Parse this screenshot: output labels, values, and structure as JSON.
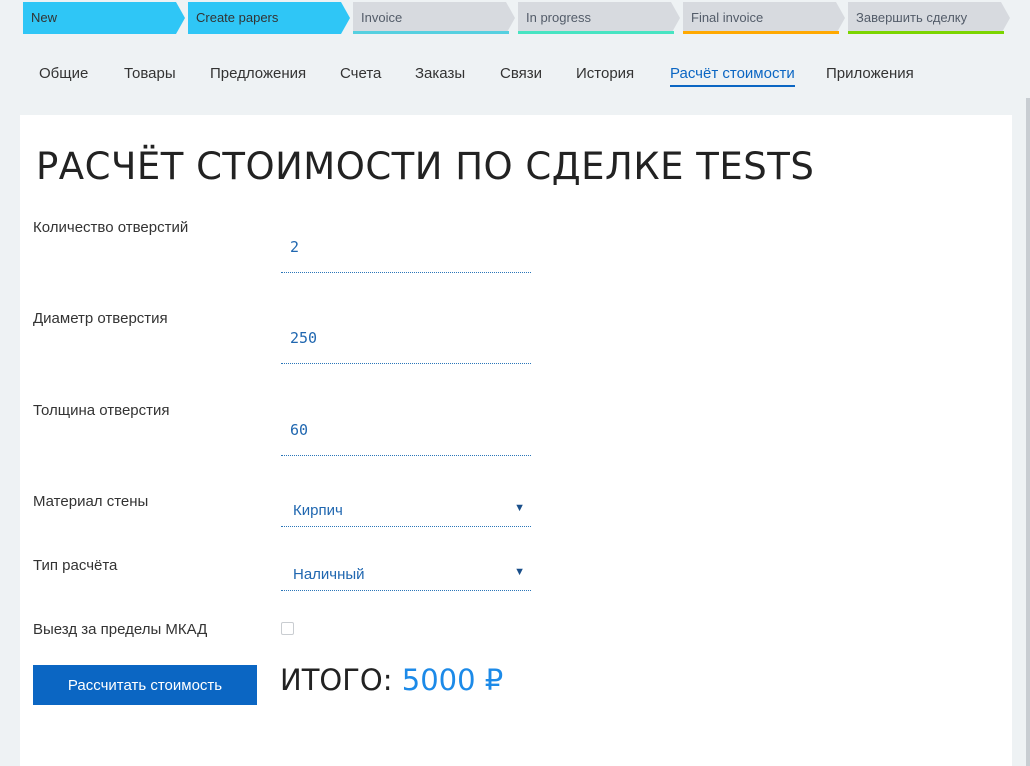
{
  "pipeline": {
    "stages": [
      {
        "label": "New",
        "color": "#2fc6f6"
      },
      {
        "label": "Create papers",
        "color": "#2fc6f6"
      },
      {
        "label": "Invoice",
        "color": "#55d0e0"
      },
      {
        "label": "In progress",
        "color": "#47e4c2"
      },
      {
        "label": "Final invoice",
        "color": "#ffa900"
      },
      {
        "label": "Завершить сделку",
        "color": "#7bd500"
      }
    ]
  },
  "tabs": [
    "Общие",
    "Товары",
    "Предложения",
    "Счета",
    "Заказы",
    "Связи",
    "История",
    "Расчёт стоимости",
    "Приложения"
  ],
  "active_tab": "Расчёт стоимости",
  "form": {
    "title": "РАСЧЁТ СТОИМОСТИ ПО СДЕЛКЕ TESTS",
    "holes_count": {
      "label": "Количество отверстий",
      "value": "2"
    },
    "hole_diameter": {
      "label": "Диаметр отверстия",
      "value": "250"
    },
    "hole_thickness": {
      "label": "Толщина отверстия",
      "value": "60"
    },
    "wall_material": {
      "label": "Материал стены",
      "value": "Кирпич"
    },
    "payment_type": {
      "label": "Тип расчёта",
      "value": "Наличный"
    },
    "outside_mkad": {
      "label": "Выезд за пределы МКАД",
      "checked": false
    },
    "calculate_button": "Рассчитать стоимость",
    "total_label": "ИТОГО:",
    "total_value": "5000 ₽"
  },
  "colors": {
    "accent": "#0b66c3",
    "total": "#1c8ae8"
  }
}
